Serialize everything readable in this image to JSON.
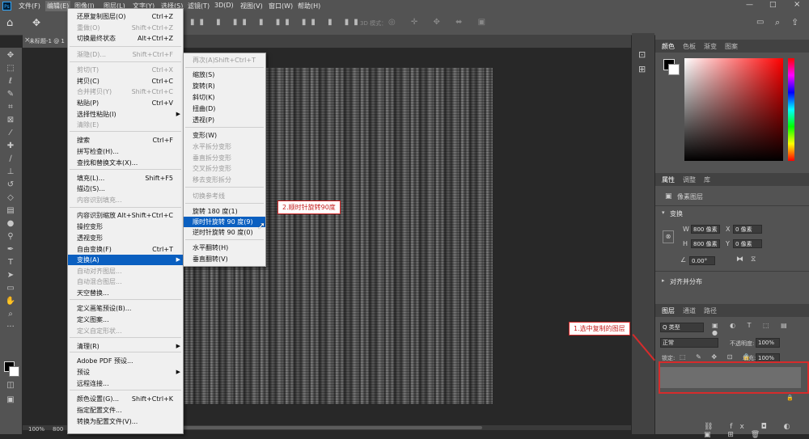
{
  "menubar": {
    "items": [
      "文件(F)",
      "编辑(E)",
      "图像(I)",
      "图层(L)",
      "文字(Y)",
      "选择(S)",
      "滤镜(T)",
      "3D(D)",
      "视图(V)",
      "窗口(W)",
      "帮助(H)"
    ],
    "ps_logo": "Ps"
  },
  "optionsbar": {
    "mode_3d": "3D 模式："
  },
  "doc_tab": {
    "title": "未标题-1 @ 1",
    "close": "×"
  },
  "statusbar": {
    "zoom": "100%",
    "size": "800 "
  },
  "edit_menu": {
    "items": [
      {
        "label": "还原复制图层(O)",
        "shortcut": "Ctrl+Z",
        "disabled": false
      },
      {
        "label": "重做(O)",
        "shortcut": "Shift+Ctrl+Z",
        "disabled": true
      },
      {
        "label": "切换最终状态",
        "shortcut": "Alt+Ctrl+Z",
        "disabled": false
      },
      {
        "label": "渐隐(D)...",
        "shortcut": "Shift+Ctrl+F",
        "disabled": true
      },
      {
        "label": "剪切(T)",
        "shortcut": "Ctrl+X",
        "disabled": true
      },
      {
        "label": "拷贝(C)",
        "shortcut": "Ctrl+C",
        "disabled": false
      },
      {
        "label": "合并拷贝(Y)",
        "shortcut": "Shift+Ctrl+C",
        "disabled": true
      },
      {
        "label": "粘贴(P)",
        "shortcut": "Ctrl+V",
        "disabled": false
      },
      {
        "label": "选择性粘贴(I)",
        "shortcut": "",
        "disabled": false,
        "submenu": true
      },
      {
        "label": "清除(E)",
        "shortcut": "",
        "disabled": true
      },
      {
        "label": "搜索",
        "shortcut": "Ctrl+F",
        "disabled": false
      },
      {
        "label": "拼写检查(H)...",
        "shortcut": "",
        "disabled": false
      },
      {
        "label": "查找和替换文本(X)...",
        "shortcut": "",
        "disabled": false
      },
      {
        "label": "填充(L)...",
        "shortcut": "Shift+F5",
        "disabled": false
      },
      {
        "label": "描边(S)...",
        "shortcut": "",
        "disabled": false
      },
      {
        "label": "内容识别填充...",
        "shortcut": "",
        "disabled": true
      },
      {
        "label": "内容识别缩放",
        "shortcut": "Alt+Shift+Ctrl+C",
        "disabled": false
      },
      {
        "label": "操控变形",
        "shortcut": "",
        "disabled": false
      },
      {
        "label": "透视变形",
        "shortcut": "",
        "disabled": false
      },
      {
        "label": "自由变换(F)",
        "shortcut": "Ctrl+T",
        "disabled": false
      },
      {
        "label": "变换(A)",
        "shortcut": "",
        "disabled": false,
        "submenu": true,
        "highlight": true
      },
      {
        "label": "自动对齐图层...",
        "shortcut": "",
        "disabled": true
      },
      {
        "label": "自动混合图层...",
        "shortcut": "",
        "disabled": true
      },
      {
        "label": "天空替换...",
        "shortcut": "",
        "disabled": false
      },
      {
        "label": "定义画笔预设(B)...",
        "shortcut": "",
        "disabled": false
      },
      {
        "label": "定义图案...",
        "shortcut": "",
        "disabled": false
      },
      {
        "label": "定义自定形状...",
        "shortcut": "",
        "disabled": true
      },
      {
        "label": "清理(R)",
        "shortcut": "",
        "disabled": false,
        "submenu": true
      },
      {
        "label": "Adobe PDF 预设...",
        "shortcut": "",
        "disabled": false
      },
      {
        "label": "预设",
        "shortcut": "",
        "disabled": false,
        "submenu": true
      },
      {
        "label": "远程连接...",
        "shortcut": "",
        "disabled": false
      },
      {
        "label": "颜色设置(G)...",
        "shortcut": "Shift+Ctrl+K",
        "disabled": false
      },
      {
        "label": "指定配置文件...",
        "shortcut": "",
        "disabled": false
      },
      {
        "label": "转换为配置文件(V)...",
        "shortcut": "",
        "disabled": false
      }
    ]
  },
  "transform_menu": {
    "items": [
      {
        "label": "再次(A)",
        "shortcut": "Shift+Ctrl+T",
        "disabled": true
      },
      {
        "label": "缩放(S)",
        "shortcut": "",
        "disabled": false
      },
      {
        "label": "旋转(R)",
        "shortcut": "",
        "disabled": false
      },
      {
        "label": "斜切(K)",
        "shortcut": "",
        "disabled": false
      },
      {
        "label": "扭曲(D)",
        "shortcut": "",
        "disabled": false
      },
      {
        "label": "透视(P)",
        "shortcut": "",
        "disabled": false
      },
      {
        "label": "变形(W)",
        "shortcut": "",
        "disabled": false
      },
      {
        "label": "水平拆分变形",
        "shortcut": "",
        "disabled": true
      },
      {
        "label": "垂直拆分变形",
        "shortcut": "",
        "disabled": true
      },
      {
        "label": "交叉拆分变形",
        "shortcut": "",
        "disabled": true
      },
      {
        "label": "移去变形拆分",
        "shortcut": "",
        "disabled": true
      },
      {
        "label": "切换参考线",
        "shortcut": "",
        "disabled": true
      },
      {
        "label": "旋转 180 度(1)",
        "shortcut": "",
        "disabled": false
      },
      {
        "label": "顺时针旋转 90 度(9)",
        "shortcut": "",
        "disabled": false,
        "highlight": true
      },
      {
        "label": "逆时针旋转 90 度(0)",
        "shortcut": "",
        "disabled": false
      },
      {
        "label": "水平翻转(H)",
        "shortcut": "",
        "disabled": false
      },
      {
        "label": "垂直翻转(V)",
        "shortcut": "",
        "disabled": false
      }
    ]
  },
  "callouts": {
    "step1": "1.选中复制的图层",
    "step2": "2.顺时针旋转90度"
  },
  "color_panel": {
    "tabs": [
      "颜色",
      "色板",
      "渐变",
      "图案"
    ]
  },
  "properties_panel": {
    "tabs": [
      "属性",
      "调整",
      "库"
    ],
    "type_label": "像素图层",
    "transform_title": "变换",
    "w_label": "W",
    "w_value": "800 像素",
    "h_label": "H",
    "h_value": "800 像素",
    "x_label": "X",
    "x_value": "0 像素",
    "y_label": "Y",
    "y_value": "0 像素",
    "angle_value": "0.00°",
    "align_title": "对齐并分布"
  },
  "layers_panel": {
    "tabs": [
      "图层",
      "通道",
      "路径"
    ],
    "filter_kind": "Q 类型",
    "blend_mode": "正常",
    "opacity_label": "不透明度:",
    "opacity_value": "100%",
    "lock_label": "锁定:",
    "fill_label": "填充:",
    "fill_value": "100%"
  },
  "colors": {
    "accent": "#0a5fc0",
    "callout_red": "#d62b2b",
    "panel_bg": "#535353",
    "dark_bg": "#282828"
  }
}
